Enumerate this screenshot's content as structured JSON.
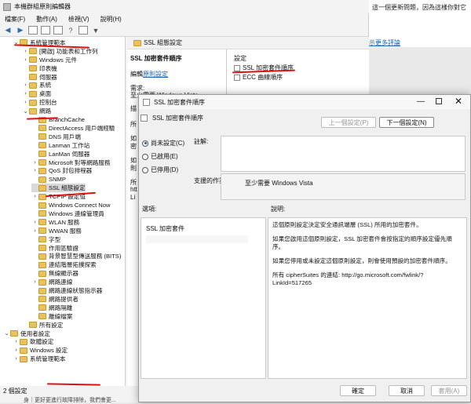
{
  "main": {
    "title": "本機群組原則編輯器",
    "menu": [
      "檔案(F)",
      "動作(A)",
      "檢視(V)",
      "說明(H)"
    ],
    "status": "2 個設定"
  },
  "tree": [
    {
      "label": "系統管理範本",
      "level": 1,
      "exp": "v",
      "hl": true
    },
    {
      "label": "[開啟] 功能表和工作列",
      "level": 2,
      "exp": ">"
    },
    {
      "label": "Windows 元件",
      "level": 2,
      "exp": ">"
    },
    {
      "label": "印表機",
      "level": 2,
      "exp": ""
    },
    {
      "label": "伺服器",
      "level": 2,
      "exp": ""
    },
    {
      "label": "系統",
      "level": 2,
      "exp": ">"
    },
    {
      "label": "桌面",
      "level": 2,
      "exp": ">"
    },
    {
      "label": "控制台",
      "level": 2,
      "exp": ">"
    },
    {
      "label": "網路",
      "level": 2,
      "exp": "v",
      "hl": true
    },
    {
      "label": "BranchCache",
      "level": 3,
      "exp": ""
    },
    {
      "label": "DirectAccess 用戶端經驗",
      "level": 3,
      "exp": ""
    },
    {
      "label": "DNS 用戶端",
      "level": 3,
      "exp": ""
    },
    {
      "label": "Lanman 工作站",
      "level": 3,
      "exp": ""
    },
    {
      "label": "LanMan 伺服器",
      "level": 3,
      "exp": ""
    },
    {
      "label": "Microsoft 對等網路服務",
      "level": 3,
      "exp": ">"
    },
    {
      "label": "QoS 封包排程器",
      "level": 3,
      "exp": ">"
    },
    {
      "label": "SNMP",
      "level": 3,
      "exp": ""
    },
    {
      "label": "SSL 組態設定",
      "level": 3,
      "exp": "",
      "sel": true
    },
    {
      "label": "TCPIP 設定值",
      "level": 3,
      "exp": ">"
    },
    {
      "label": "Windows Connect Now",
      "level": 3,
      "exp": ""
    },
    {
      "label": "Windows 連線管理員",
      "level": 3,
      "exp": ""
    },
    {
      "label": "WLAN 服務",
      "level": 3,
      "exp": ">"
    },
    {
      "label": "WWAN 服務",
      "level": 3,
      "exp": ">"
    },
    {
      "label": "字型",
      "level": 3,
      "exp": ""
    },
    {
      "label": "作用區驗證",
      "level": 3,
      "exp": ""
    },
    {
      "label": "背景智慧型傳送服務 (BITS)",
      "level": 3,
      "exp": ""
    },
    {
      "label": "連結階層拓撲探索",
      "level": 3,
      "exp": ""
    },
    {
      "label": "無線顯示器",
      "level": 3,
      "exp": ""
    },
    {
      "label": "網路連線",
      "level": 3,
      "exp": ">"
    },
    {
      "label": "網路連線狀態指示器",
      "level": 3,
      "exp": ""
    },
    {
      "label": "網路提供者",
      "level": 3,
      "exp": ""
    },
    {
      "label": "網路隔離",
      "level": 3,
      "exp": ""
    },
    {
      "label": "離線檔案",
      "level": 3,
      "exp": ""
    },
    {
      "label": "所有設定",
      "level": 2,
      "exp": ""
    },
    {
      "label": "使用者設定",
      "level": 0,
      "exp": "v"
    },
    {
      "label": "軟體設定",
      "level": 1,
      "exp": ">"
    },
    {
      "label": "Windows 設定",
      "level": 1,
      "exp": ">"
    },
    {
      "label": "系統管理範本",
      "level": 1,
      "exp": ">"
    }
  ],
  "mid": {
    "header": "SSL 組態設定",
    "policy_title": "SSL 加密套件順序",
    "edit_prefix": "編輯",
    "edit_link": "原則設定",
    "req_label": "需求:",
    "req_text": "至少需要 Windows Vista",
    "desc_label": "描述:",
    "col_header": "設定",
    "items": [
      "SSL 加密套件順序",
      "ECC 曲線順序"
    ],
    "trunc": [
      "描",
      "所",
      "如",
      "密",
      "如",
      "則",
      "所",
      "htt",
      "Li"
    ]
  },
  "browser": {
    "line1": "這一個更新問題，因為這樣你對它",
    "line2": "示更多評論"
  },
  "dialog": {
    "title": "SSL 加密套件順序",
    "subtitle": "SSL 加密套件順序",
    "prev": "上一個設定(P)",
    "next": "下一個設定(N)",
    "radios": [
      "尚未設定(C)",
      "已啟用(E)",
      "已停用(D)"
    ],
    "comment_label": "註解:",
    "supported_label": "支援的作業系統:",
    "supported_value": "至少需要 Windows Vista",
    "options_label": "選項:",
    "help_label": "說明:",
    "option_item": "SSL 加密套件",
    "help": [
      "這個原則設定決定安全通訊端層 (SSL) 所用的加密套件。",
      "如果您啟用這個原則設定，SSL 加密套件會按指定的順序設定優先順序。",
      "如果您停用或未設定這個原則設定，則會使用預設的加密套件順序。",
      "所有 cipherSuites 的連結: http://go.microsoft.com/fwlink/?",
      "LinkId=517265"
    ],
    "ok": "確定",
    "cancel": "取消",
    "apply": "套用(A)"
  },
  "bottom_text": "身｜更好更進行故障排除，我們會更...",
  "colors": {
    "accent": "#1a5fb4",
    "highlight": "#d11111",
    "folder": "#e9c25a"
  }
}
